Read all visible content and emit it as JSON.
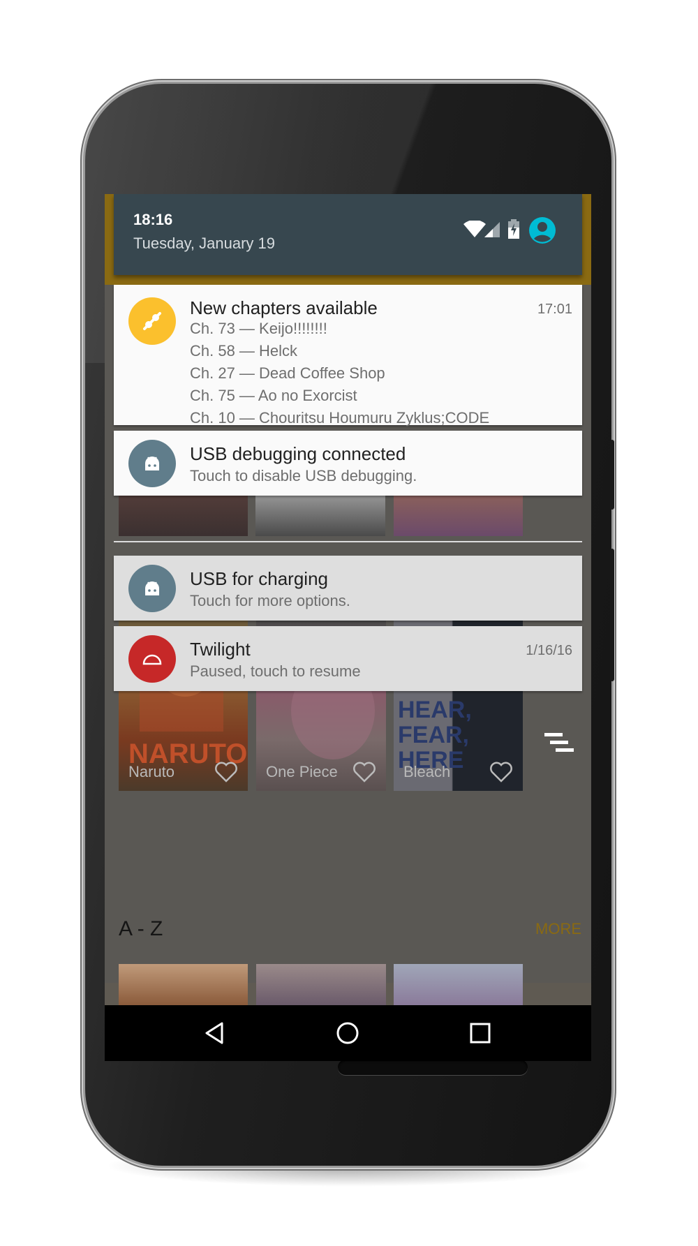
{
  "status_bar": {
    "time": "18:16",
    "date": "Tuesday, January 19",
    "icons": [
      "wifi-icon",
      "cell-signal-icon",
      "battery-charging-icon",
      "user-avatar-icon"
    ],
    "accent_color": "#00bcd4"
  },
  "notifications": [
    {
      "app_icon": "manga-reader-icon",
      "icon_color": "#fbc02d",
      "title": "New chapters available",
      "time": "17:01",
      "lines": [
        "Ch. 73 — Keijo!!!!!!!!",
        "Ch. 58 — Helck",
        "Ch. 27 — Dead Coffee Shop",
        "Ch. 75 — Ao no Exorcist",
        "Ch. 10 — Chouritsu Houmuru Zyklus;CODE"
      ]
    },
    {
      "app_icon": "android-icon",
      "icon_color": "#607d8b",
      "title": "USB debugging connected",
      "text": "Touch to disable USB debugging."
    },
    {
      "app_icon": "android-icon",
      "icon_color": "#607d8b",
      "title": "USB for charging",
      "text": "Touch for more options."
    },
    {
      "app_icon": "twilight-icon",
      "icon_color": "#c62828",
      "title": "Twilight",
      "time": "1/16/16",
      "text": "Paused, touch to resume"
    }
  ],
  "library": {
    "covers": [
      {
        "title": "Naruto"
      },
      {
        "title": "One Piece"
      },
      {
        "title": "Bleach"
      }
    ],
    "section_title": "A - Z",
    "more_label": "MORE"
  },
  "navigation": [
    "back-icon",
    "home-icon",
    "recents-icon"
  ]
}
